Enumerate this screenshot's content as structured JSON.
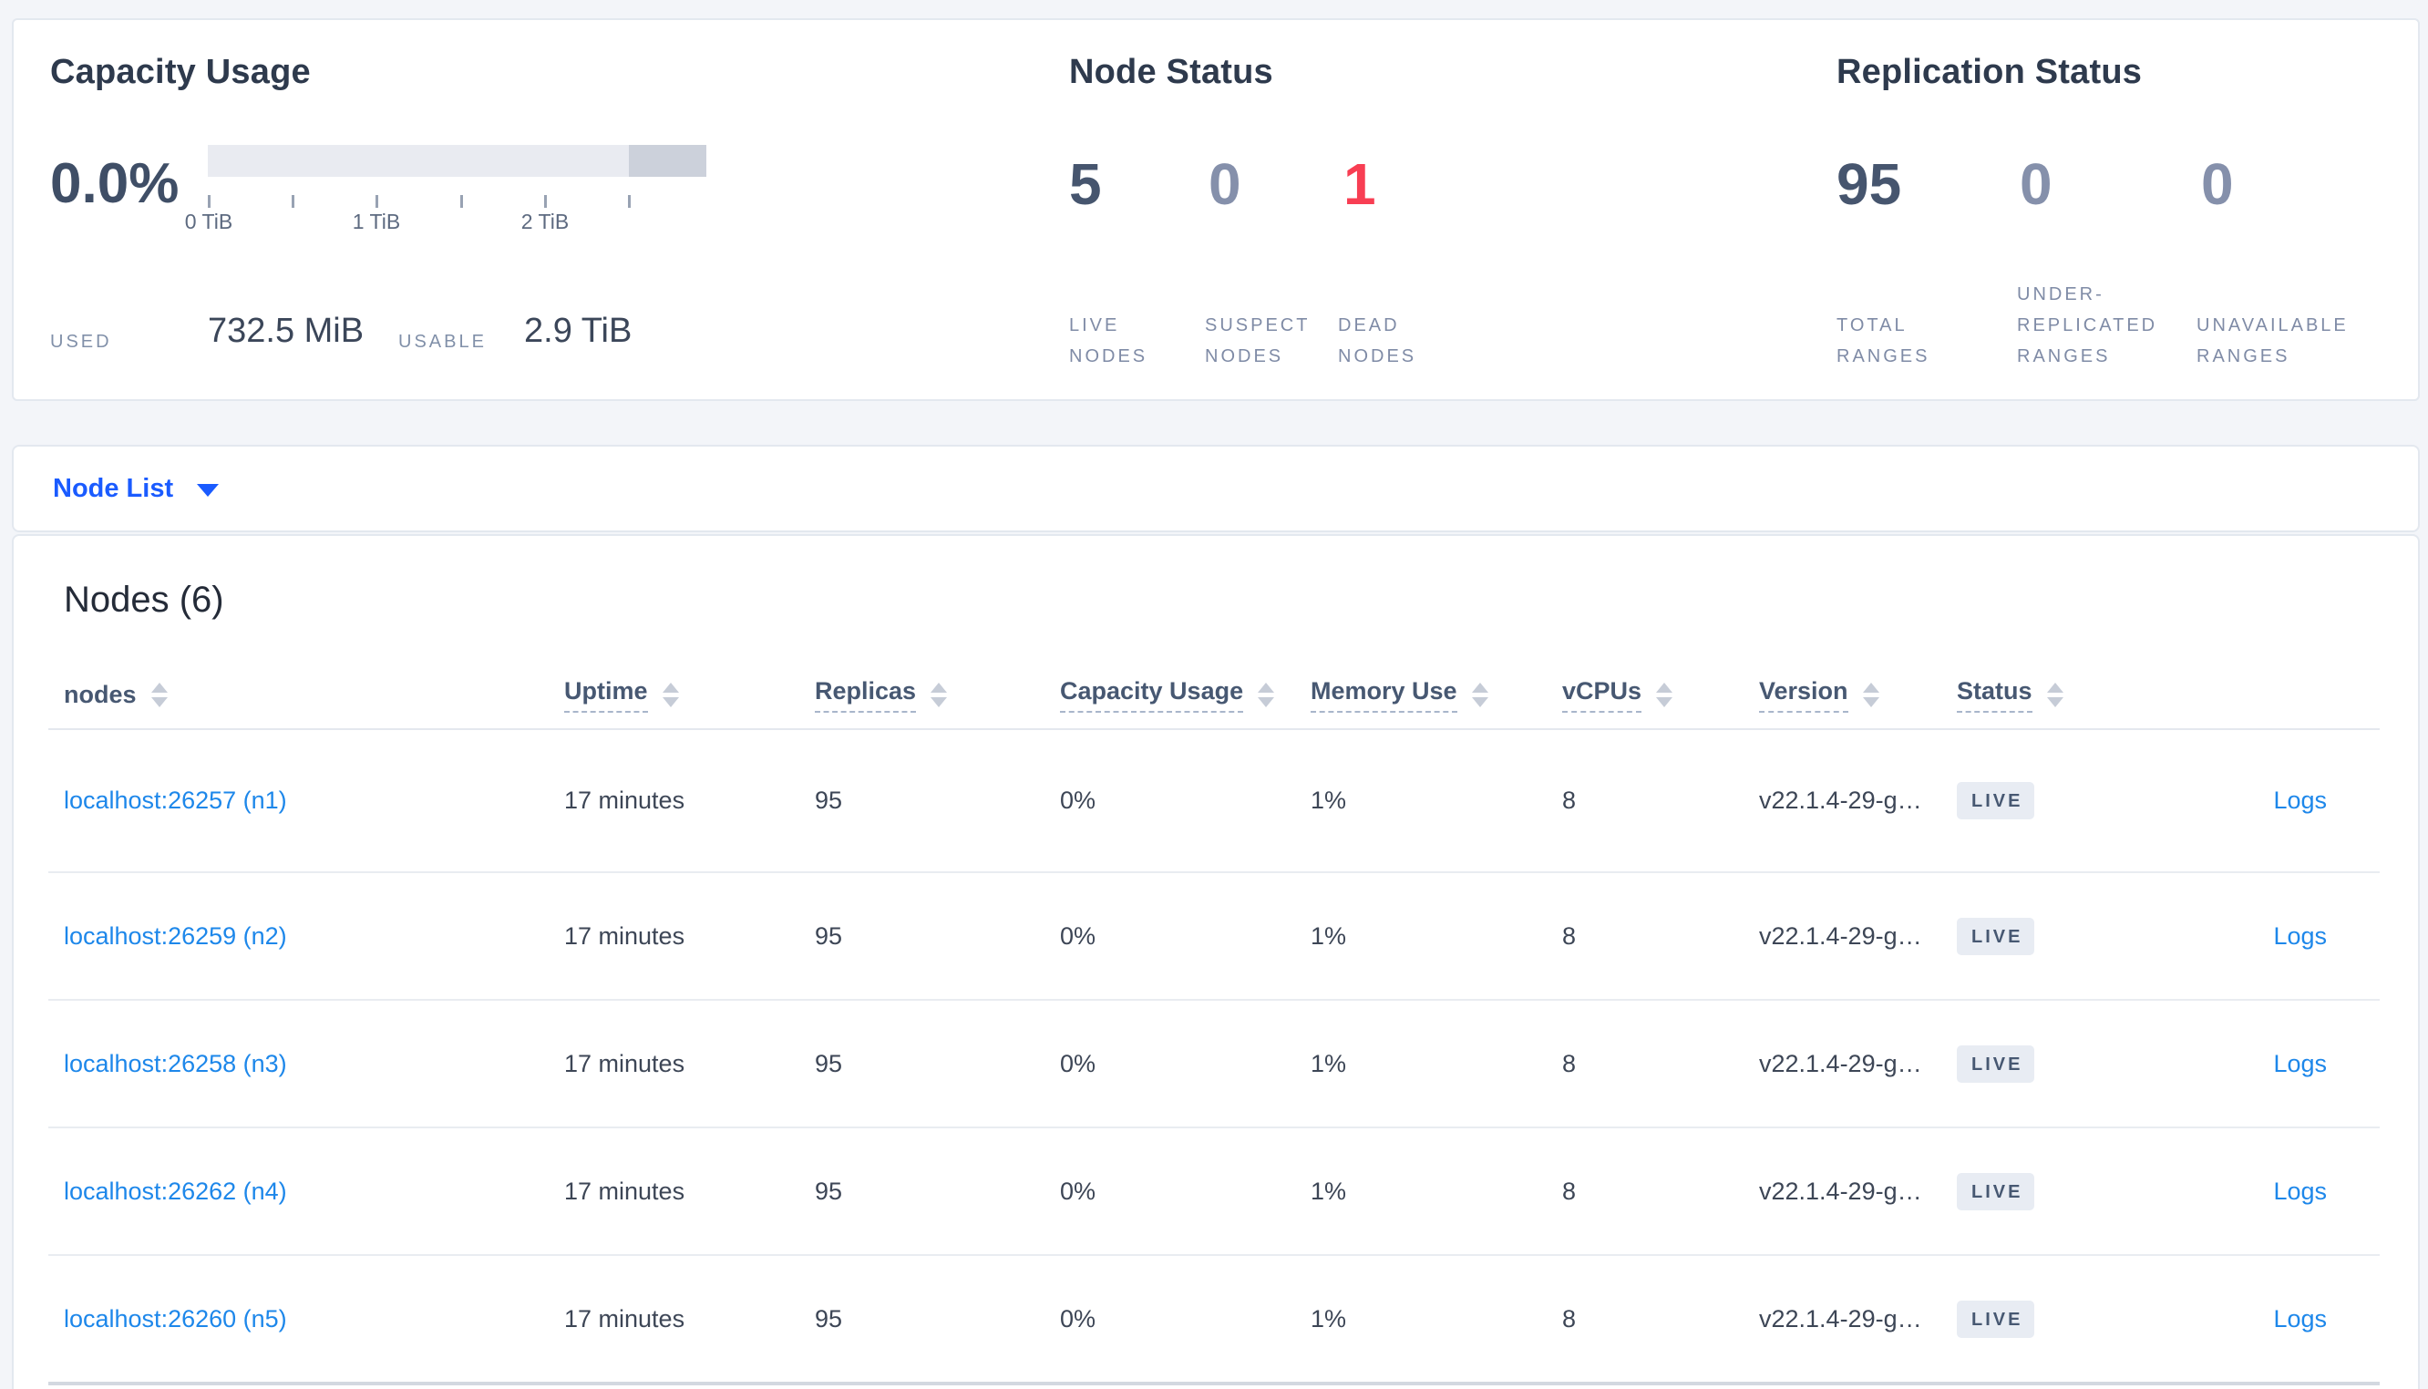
{
  "summary": {
    "capacity": {
      "title": "Capacity Usage",
      "percent": "0.0%",
      "tick_labels": [
        "0 TiB",
        "1 TiB",
        "2 TiB"
      ],
      "used_label": "USED",
      "used_value": "732.5 MiB",
      "usable_label": "USABLE",
      "usable_value": "2.9 TiB"
    },
    "node_status": {
      "title": "Node Status",
      "metrics": [
        {
          "value": "5",
          "label": "LIVE\nNODES",
          "tone": "dark"
        },
        {
          "value": "0",
          "label": "SUSPECT\nNODES",
          "tone": "muted"
        },
        {
          "value": "1",
          "label": "DEAD\nNODES",
          "tone": "danger"
        }
      ]
    },
    "replication_status": {
      "title": "Replication Status",
      "metrics": [
        {
          "value": "95",
          "label": "TOTAL\nRANGES",
          "tone": "dark"
        },
        {
          "value": "0",
          "label": "UNDER-\nREPLICATED\nRANGES",
          "tone": "muted"
        },
        {
          "value": "0",
          "label": "UNAVAILABLE\nRANGES",
          "tone": "muted"
        }
      ]
    }
  },
  "view_switcher": {
    "selected": "Node List"
  },
  "nodes": {
    "heading": "Nodes (6)",
    "columns": [
      {
        "key": "address",
        "label": "nodes",
        "sortable": true,
        "tooltip": false
      },
      {
        "key": "uptime",
        "label": "Uptime",
        "sortable": true,
        "tooltip": true
      },
      {
        "key": "replicas",
        "label": "Replicas",
        "sortable": true,
        "tooltip": true
      },
      {
        "key": "capacity",
        "label": "Capacity Usage",
        "sortable": true,
        "tooltip": true
      },
      {
        "key": "memory",
        "label": "Memory Use",
        "sortable": true,
        "tooltip": true
      },
      {
        "key": "vcpus",
        "label": "vCPUs",
        "sortable": true,
        "tooltip": true
      },
      {
        "key": "version",
        "label": "Version",
        "sortable": true,
        "tooltip": true
      },
      {
        "key": "status",
        "label": "Status",
        "sortable": true,
        "tooltip": true
      }
    ],
    "rows": [
      {
        "address": "localhost:26257 (n1)",
        "uptime": "17 minutes",
        "replicas": "95",
        "capacity": "0%",
        "memory": "1%",
        "vcpus": "8",
        "version": "v22.1.4-29-g…",
        "status": "LIVE",
        "logs": "Logs"
      },
      {
        "address": "localhost:26259 (n2)",
        "uptime": "17 minutes",
        "replicas": "95",
        "capacity": "0%",
        "memory": "1%",
        "vcpus": "8",
        "version": "v22.1.4-29-g…",
        "status": "LIVE",
        "logs": "Logs"
      },
      {
        "address": "localhost:26258 (n3)",
        "uptime": "17 minutes",
        "replicas": "95",
        "capacity": "0%",
        "memory": "1%",
        "vcpus": "8",
        "version": "v22.1.4-29-g…",
        "status": "LIVE",
        "logs": "Logs"
      },
      {
        "address": "localhost:26262 (n4)",
        "uptime": "17 minutes",
        "replicas": "95",
        "capacity": "0%",
        "memory": "1%",
        "vcpus": "8",
        "version": "v22.1.4-29-g…",
        "status": "LIVE",
        "logs": "Logs"
      },
      {
        "address": "localhost:26260 (n5)",
        "uptime": "17 minutes",
        "replicas": "95",
        "capacity": "0%",
        "memory": "1%",
        "vcpus": "8",
        "version": "v22.1.4-29-g…",
        "status": "LIVE",
        "logs": "Logs"
      }
    ]
  },
  "colors": {
    "accent_blue": "#1a5bff",
    "link_blue": "#1d87ea",
    "danger_red": "#f83e53",
    "dark_slate": "#46556e",
    "muted_slate": "#8590ab"
  }
}
